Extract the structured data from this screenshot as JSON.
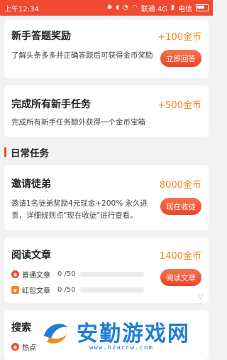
{
  "status_bar": {
    "time": "上午12:34",
    "carrier": "联通 4G",
    "carrier2": "电信",
    "icons": [
      "bluetooth-icon",
      "mute-icon",
      "alarm-icon",
      "wifi-icon",
      "signal-icon",
      "battery-icon"
    ]
  },
  "tasks": [
    {
      "title": "新手答题奖励",
      "reward": "+100金币",
      "description": "了解头条多多并正确答题后可获得金币奖励",
      "button": "立即回答"
    },
    {
      "title": "完成所有新手任务",
      "reward": "+500金币",
      "description": "完成所有新手任务额外获得一个金币宝箱"
    }
  ],
  "section": {
    "title": "日常任务"
  },
  "invite": {
    "title": "邀请徒弟",
    "reward": "8000金币",
    "description": "邀请1名徒弟奖励4元现金+200% 永久进贡，详细规则点\"现在收徒\"进行查看。",
    "button": "现在收徒"
  },
  "read": {
    "title": "阅读文章",
    "reward": "1400金币",
    "button": "阅读文章",
    "rows": [
      {
        "label": "普通文章",
        "count": "0 /50",
        "progress": 0,
        "icon_color": "#ef4a2f"
      },
      {
        "label": "红包文章",
        "count": "0 /50",
        "progress": 0,
        "icon_color": "#f08a1d"
      }
    ]
  },
  "search": {
    "title_partial": "搜索",
    "row_label_partial": "热点"
  },
  "watermark": {
    "text": "安勤游戏网",
    "url": "www.hzaccw.com",
    "color": "#1e7fd6"
  }
}
